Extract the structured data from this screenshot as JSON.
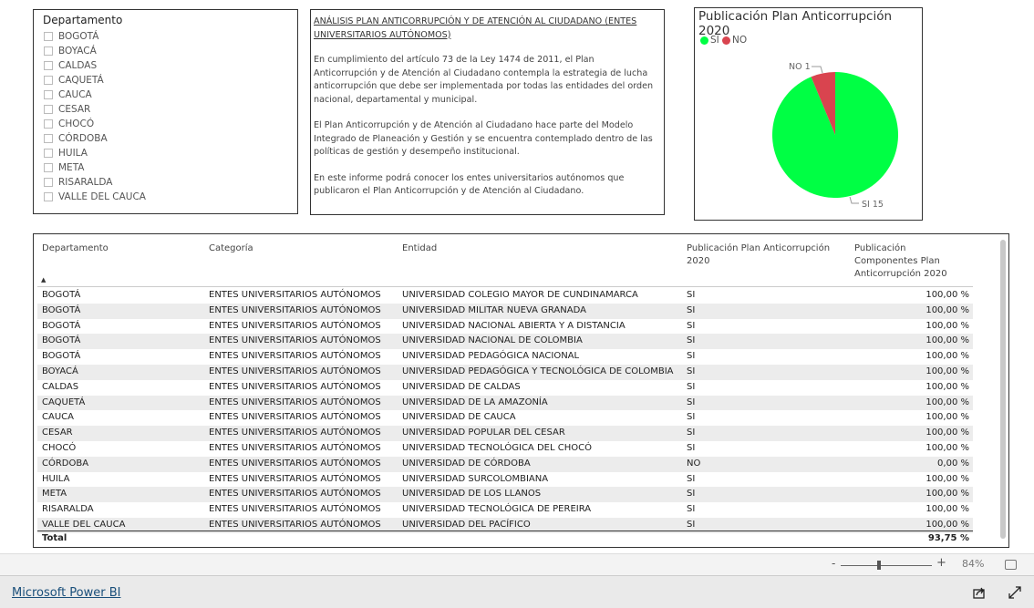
{
  "slicer": {
    "title": "Departamento",
    "items": [
      "BOGOTÁ",
      "BOYACÁ",
      "CALDAS",
      "CAQUETÁ",
      "CAUCA",
      "CESAR",
      "CHOCÓ",
      "CÓRDOBA",
      "HUILA",
      "META",
      "RISARALDA",
      "VALLE DEL CAUCA"
    ]
  },
  "textbox": {
    "heading": "ANÁLISIS PLAN ANTICORRUPCIÓN Y DE ATENCIÓN AL CIUDADANO (ENTES UNIVERSITARIOS AUTÓNOMOS)",
    "paragraphs": [
      "En cumplimiento del artículo 73 de la Ley 1474 de 2011, el Plan Anticorrupción y de Atención al Ciudadano contempla la estrategia de lucha anticorrupción que debe ser implementada por todas las entidades del orden nacional, departamental y municipal.",
      "El Plan Anticorrupción y de Atención al Ciudadano hace parte del Modelo Integrado de Planeación y Gestión y se encuentra contemplado dentro de las políticas de gestión y desempeño institucional.",
      "En este informe podrá conocer los entes universitarios autónomos que publicaron el Plan Anticorrupción y de Atención al Ciudadano."
    ]
  },
  "pie": {
    "title": "Publicación Plan Anticorrupción 2020",
    "legend": [
      {
        "label": "SI",
        "color": "#00ff44"
      },
      {
        "label": "NO",
        "color": "#d9444f"
      }
    ],
    "labels": {
      "no": "NO 1",
      "si": "SI 15"
    },
    "values": {
      "SI": 15,
      "NO": 1
    }
  },
  "table": {
    "headers": [
      "Departamento",
      "Categoría",
      "Entidad",
      "Publicación Plan Anticorrupción 2020",
      "Publicación Componentes Plan Anticorrupción 2020"
    ],
    "sort_indicator": "▲",
    "rows": [
      [
        "BOGOTÁ",
        "ENTES UNIVERSITARIOS AUTÓNOMOS",
        "UNIVERSIDAD COLEGIO MAYOR DE CUNDINAMARCA",
        "SI",
        "100,00 %"
      ],
      [
        "BOGOTÁ",
        "ENTES UNIVERSITARIOS AUTÓNOMOS",
        "UNIVERSIDAD MILITAR NUEVA GRANADA",
        "SI",
        "100,00 %"
      ],
      [
        "BOGOTÁ",
        "ENTES UNIVERSITARIOS AUTÓNOMOS",
        "UNIVERSIDAD NACIONAL ABIERTA Y A DISTANCIA",
        "SI",
        "100,00 %"
      ],
      [
        "BOGOTÁ",
        "ENTES UNIVERSITARIOS AUTÓNOMOS",
        "UNIVERSIDAD NACIONAL DE COLOMBIA",
        "SI",
        "100,00 %"
      ],
      [
        "BOGOTÁ",
        "ENTES UNIVERSITARIOS AUTÓNOMOS",
        "UNIVERSIDAD PEDAGÓGICA NACIONAL",
        "SI",
        "100,00 %"
      ],
      [
        "BOYACÁ",
        "ENTES UNIVERSITARIOS AUTÓNOMOS",
        "UNIVERSIDAD PEDAGÓGICA Y TECNOLÓGICA DE COLOMBIA",
        "SI",
        "100,00 %"
      ],
      [
        "CALDAS",
        "ENTES UNIVERSITARIOS AUTÓNOMOS",
        "UNIVERSIDAD DE CALDAS",
        "SI",
        "100,00 %"
      ],
      [
        "CAQUETÁ",
        "ENTES UNIVERSITARIOS AUTÓNOMOS",
        "UNIVERSIDAD DE LA AMAZONÍA",
        "SI",
        "100,00 %"
      ],
      [
        "CAUCA",
        "ENTES UNIVERSITARIOS AUTÓNOMOS",
        "UNIVERSIDAD DE CAUCA",
        "SI",
        "100,00 %"
      ],
      [
        "CESAR",
        "ENTES UNIVERSITARIOS AUTÓNOMOS",
        "UNIVERSIDAD POPULAR DEL CESAR",
        "SI",
        "100,00 %"
      ],
      [
        "CHOCÓ",
        "ENTES UNIVERSITARIOS AUTÓNOMOS",
        "UNIVERSIDAD TECNOLÓGICA DEL CHOCÓ",
        "SI",
        "100,00 %"
      ],
      [
        "CÓRDOBA",
        "ENTES UNIVERSITARIOS AUTÓNOMOS",
        "UNIVERSIDAD DE CÓRDOBA",
        "NO",
        "0,00 %"
      ],
      [
        "HUILA",
        "ENTES UNIVERSITARIOS AUTÓNOMOS",
        "UNIVERSIDAD SURCOLOMBIANA",
        "SI",
        "100,00 %"
      ],
      [
        "META",
        "ENTES UNIVERSITARIOS AUTÓNOMOS",
        "UNIVERSIDAD DE LOS LLANOS",
        "SI",
        "100,00 %"
      ],
      [
        "RISARALDA",
        "ENTES UNIVERSITARIOS AUTÓNOMOS",
        "UNIVERSIDAD TECNOLÓGICA DE PEREIRA",
        "SI",
        "100,00 %"
      ],
      [
        "VALLE DEL CAUCA",
        "ENTES UNIVERSITARIOS AUTÓNOMOS",
        "UNIVERSIDAD DEL PACÍFICO",
        "SI",
        "100,00 %"
      ]
    ],
    "total_label": "Total",
    "total_value": "93,75 %"
  },
  "zoom": {
    "minus": "-",
    "plus": "+",
    "level": "84%",
    "level_fraction": 0.42
  },
  "footer": {
    "brand": "Microsoft Power BI"
  }
}
